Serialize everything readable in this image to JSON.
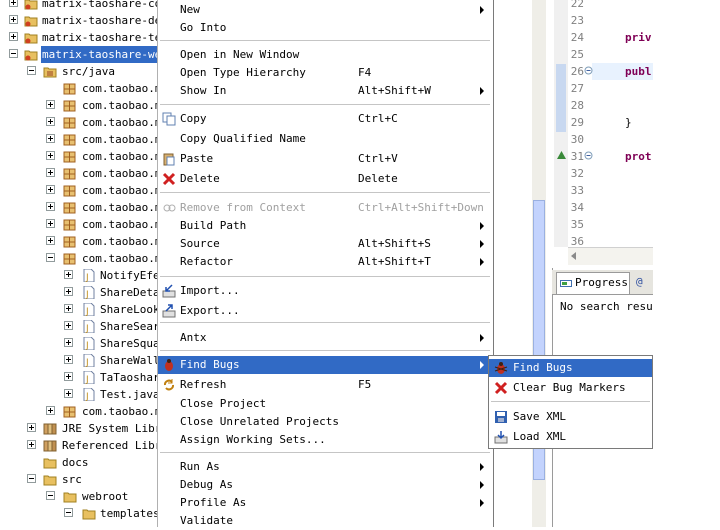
{
  "tree": {
    "projects": [
      {
        "label": "matrix-taoshare-com"
      },
      {
        "label": "matrix-taoshare-dep"
      },
      {
        "label": "matrix-taoshare-tes"
      },
      {
        "label": "matrix-taoshare-web"
      }
    ],
    "src_folder": "src/java",
    "packages": [
      "com.taobao.ma",
      "com.taobao.ma",
      "com.taobao.ma",
      "com.taobao.ma",
      "com.taobao.ma",
      "com.taobao.ma",
      "com.taobao.ma",
      "com.taobao.ma",
      "com.taobao.ma",
      "com.taobao.ma",
      "com.taobao.ma"
    ],
    "classes": [
      "NotifyEfe",
      "ShareDeta",
      "ShareLook",
      "ShareSear",
      "ShareSqua",
      "ShareWall",
      "TaTaoshar",
      "Test.java"
    ],
    "after_classes_pkg": "com.taobao.ma",
    "jre": "JRE System Libra",
    "referenced": "Referenced Libra",
    "docs": "docs",
    "src": "src",
    "webroot": "webroot",
    "templates": "templates"
  },
  "editor": {
    "line_numbers": [
      "22",
      "23",
      "24",
      "25",
      "26",
      "27",
      "28",
      "29",
      "30",
      "31",
      "32",
      "33",
      "34",
      "35",
      "36"
    ],
    "code": {
      "l24": "priv",
      "l26": "publ",
      "l29": "}",
      "l31": "prot"
    }
  },
  "views": {
    "tab_progress": "Progress",
    "tab_other": "@",
    "content": "No search result"
  },
  "menu": {
    "items": [
      {
        "label": "New",
        "mnemonic": "N",
        "shortcut": "",
        "submenu": true
      },
      {
        "label": "Go Into",
        "shortcut": "",
        "submenu": false
      },
      {
        "label": "Open in New Window",
        "shortcut": "",
        "submenu": false
      },
      {
        "label": "Open Type Hierarchy",
        "shortcut": "F4",
        "submenu": false
      },
      {
        "label": "Show In",
        "shortcut": "Alt+Shift+W",
        "submenu": true
      },
      {
        "label": "Copy",
        "shortcut": "Ctrl+C",
        "submenu": false
      },
      {
        "label": "Copy Qualified Name",
        "shortcut": "",
        "submenu": false
      },
      {
        "label": "Paste",
        "shortcut": "Ctrl+V",
        "submenu": false
      },
      {
        "label": "Delete",
        "shortcut": "Delete",
        "submenu": false
      },
      {
        "label": "Remove from Context",
        "shortcut": "Ctrl+Alt+Shift+Down",
        "submenu": false,
        "disabled": true
      },
      {
        "label": "Build Path",
        "shortcut": "",
        "submenu": true
      },
      {
        "label": "Source",
        "shortcut": "Alt+Shift+S",
        "submenu": true
      },
      {
        "label": "Refactor",
        "shortcut": "Alt+Shift+T",
        "submenu": true
      },
      {
        "label": "Import...",
        "shortcut": "",
        "submenu": false
      },
      {
        "label": "Export...",
        "shortcut": "",
        "submenu": false
      },
      {
        "label": "Antx",
        "shortcut": "",
        "submenu": true
      },
      {
        "label": "Find Bugs",
        "shortcut": "",
        "submenu": true,
        "highlighted": true
      },
      {
        "label": "Refresh",
        "shortcut": "F5",
        "submenu": false
      },
      {
        "label": "Close Project",
        "shortcut": "",
        "submenu": false
      },
      {
        "label": "Close Unrelated Projects",
        "shortcut": "",
        "submenu": false
      },
      {
        "label": "Assign Working Sets...",
        "shortcut": "",
        "submenu": false
      },
      {
        "label": "Run As",
        "shortcut": "",
        "submenu": true
      },
      {
        "label": "Debug As",
        "shortcut": "",
        "submenu": true
      },
      {
        "label": "Profile As",
        "shortcut": "",
        "submenu": true
      },
      {
        "label": "Validate",
        "shortcut": "",
        "submenu": false
      }
    ]
  },
  "submenu": {
    "items": [
      {
        "label": "Find Bugs",
        "highlighted": true
      },
      {
        "label": "Clear Bug Markers"
      },
      {
        "label": "Save XML"
      },
      {
        "label": "Load XML"
      }
    ]
  },
  "colors": {
    "selection": "#316ac5",
    "keyword": "#7f0055",
    "line_number": "#808080"
  }
}
